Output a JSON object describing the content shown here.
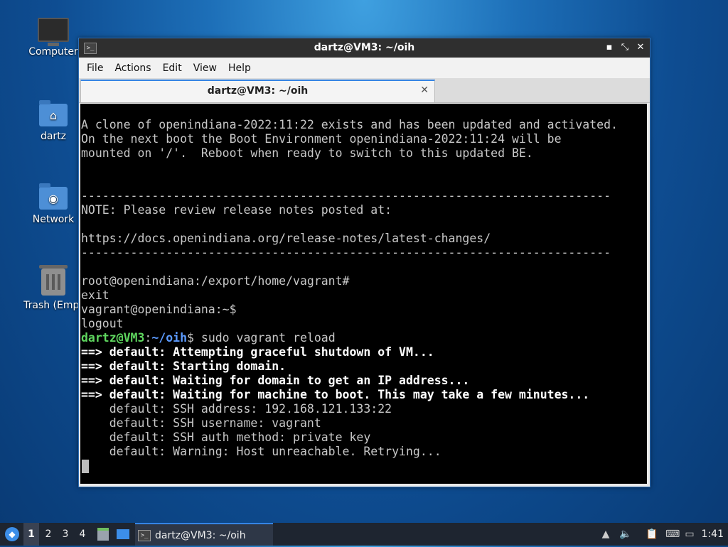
{
  "desktop": {
    "icons": [
      {
        "label": "Computer"
      },
      {
        "label": "dartz"
      },
      {
        "label": "Network"
      },
      {
        "label": "Trash (Empt"
      }
    ]
  },
  "window": {
    "title": "dartz@VM3: ~/oih",
    "buttons": {
      "minimize": "▪",
      "maximize": "⤡",
      "close": "✕"
    },
    "menu": [
      "File",
      "Actions",
      "Edit",
      "View",
      "Help"
    ],
    "tab": {
      "label": "dartz@VM3: ~/oih",
      "close": "✕"
    }
  },
  "terminal": {
    "lines": [
      "A clone of openindiana-2022:11:22 exists and has been updated and activated.",
      "On the next boot the Boot Environment openindiana-2022:11:24 will be",
      "mounted on '/'.  Reboot when ready to switch to this updated BE.",
      "",
      "",
      "---------------------------------------------------------------------------",
      "NOTE: Please review release notes posted at:",
      "",
      "https://docs.openindiana.org/release-notes/latest-changes/",
      "---------------------------------------------------------------------------",
      "",
      "root@openindiana:/export/home/vagrant#",
      "exit",
      "vagrant@openindiana:~$",
      "logout"
    ],
    "prompt": {
      "user_host": "dartz@VM3",
      "sep": ":",
      "path": "~/oih",
      "cmd": "$ sudo vagrant reload"
    },
    "vagrant_bold": [
      "==> default: Attempting graceful shutdown of VM...",
      "==> default: Starting domain.",
      "==> default: Waiting for domain to get an IP address...",
      "==> default: Waiting for machine to boot. This may take a few minutes..."
    ],
    "vagrant_info": [
      "    default: SSH address: 192.168.121.133:22",
      "    default: SSH username: vagrant",
      "    default: SSH auth method: private key",
      "    default: Warning: Host unreachable. Retrying..."
    ]
  },
  "taskbar": {
    "workspaces": [
      "1",
      "2",
      "3",
      "4"
    ],
    "task_label": "dartz@VM3: ~/oih",
    "clock": "1:41"
  }
}
